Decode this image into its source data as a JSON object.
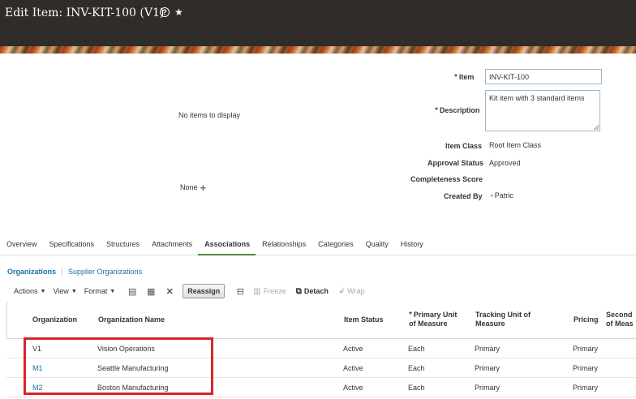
{
  "header": {
    "title": "Edit Item: INV-KIT-100 (V1)",
    "help_glyph": "?"
  },
  "left_panel": {
    "no_items": "No items to display",
    "none_label": "None"
  },
  "form": {
    "item_label": "Item",
    "item_value": "INV-KIT-100",
    "description_label": "Description",
    "description_value": "Kit item with 3 standard items",
    "item_class_label": "Item Class",
    "item_class_value": "Root Item Class",
    "approval_status_label": "Approval Status",
    "approval_status_value": "Approved",
    "completeness_label": "Completeness Score",
    "created_by_label": "Created By",
    "created_by_value": "Patric"
  },
  "tabs": [
    "Overview",
    "Specifications",
    "Structures",
    "Attachments",
    "Associations",
    "Relationships",
    "Categories",
    "Quality",
    "History"
  ],
  "subtabs": [
    "Organizations",
    "Supplier Organizations"
  ],
  "toolbar": {
    "actions": "Actions",
    "view": "View",
    "format": "Format",
    "reassign": "Reassign",
    "freeze": "Freeze",
    "detach": "Detach",
    "wrap": "Wrap"
  },
  "table": {
    "headers": {
      "organization": "Organization",
      "organization_name": "Organization Name",
      "item_status": "Item Status",
      "primary_uom_1": "Primary Unit",
      "primary_uom_2": "of Measure",
      "tracking_uom_1": "Tracking Unit of",
      "tracking_uom_2": "Measure",
      "pricing": "Pricing",
      "secondary_1": "Second",
      "secondary_2": "of Meas"
    },
    "rows": [
      {
        "org": "V1",
        "name": "Vision Operations",
        "status": "Active",
        "primary": "Each",
        "tracking": "Primary",
        "pricing": "Primary"
      },
      {
        "org": "M1",
        "name": "Seattle Manufacturing",
        "status": "Active",
        "primary": "Each",
        "tracking": "Primary",
        "pricing": "Primary"
      },
      {
        "org": "M2",
        "name": "Boston Manufacturing",
        "status": "Active",
        "primary": "Each",
        "tracking": "Primary",
        "pricing": "Primary"
      }
    ]
  },
  "colors": {
    "header_bg": "#2f2c2a",
    "link": "#1d6fa5",
    "active_tab_underline": "#4f8a3c",
    "highlight": "#d9232a"
  }
}
